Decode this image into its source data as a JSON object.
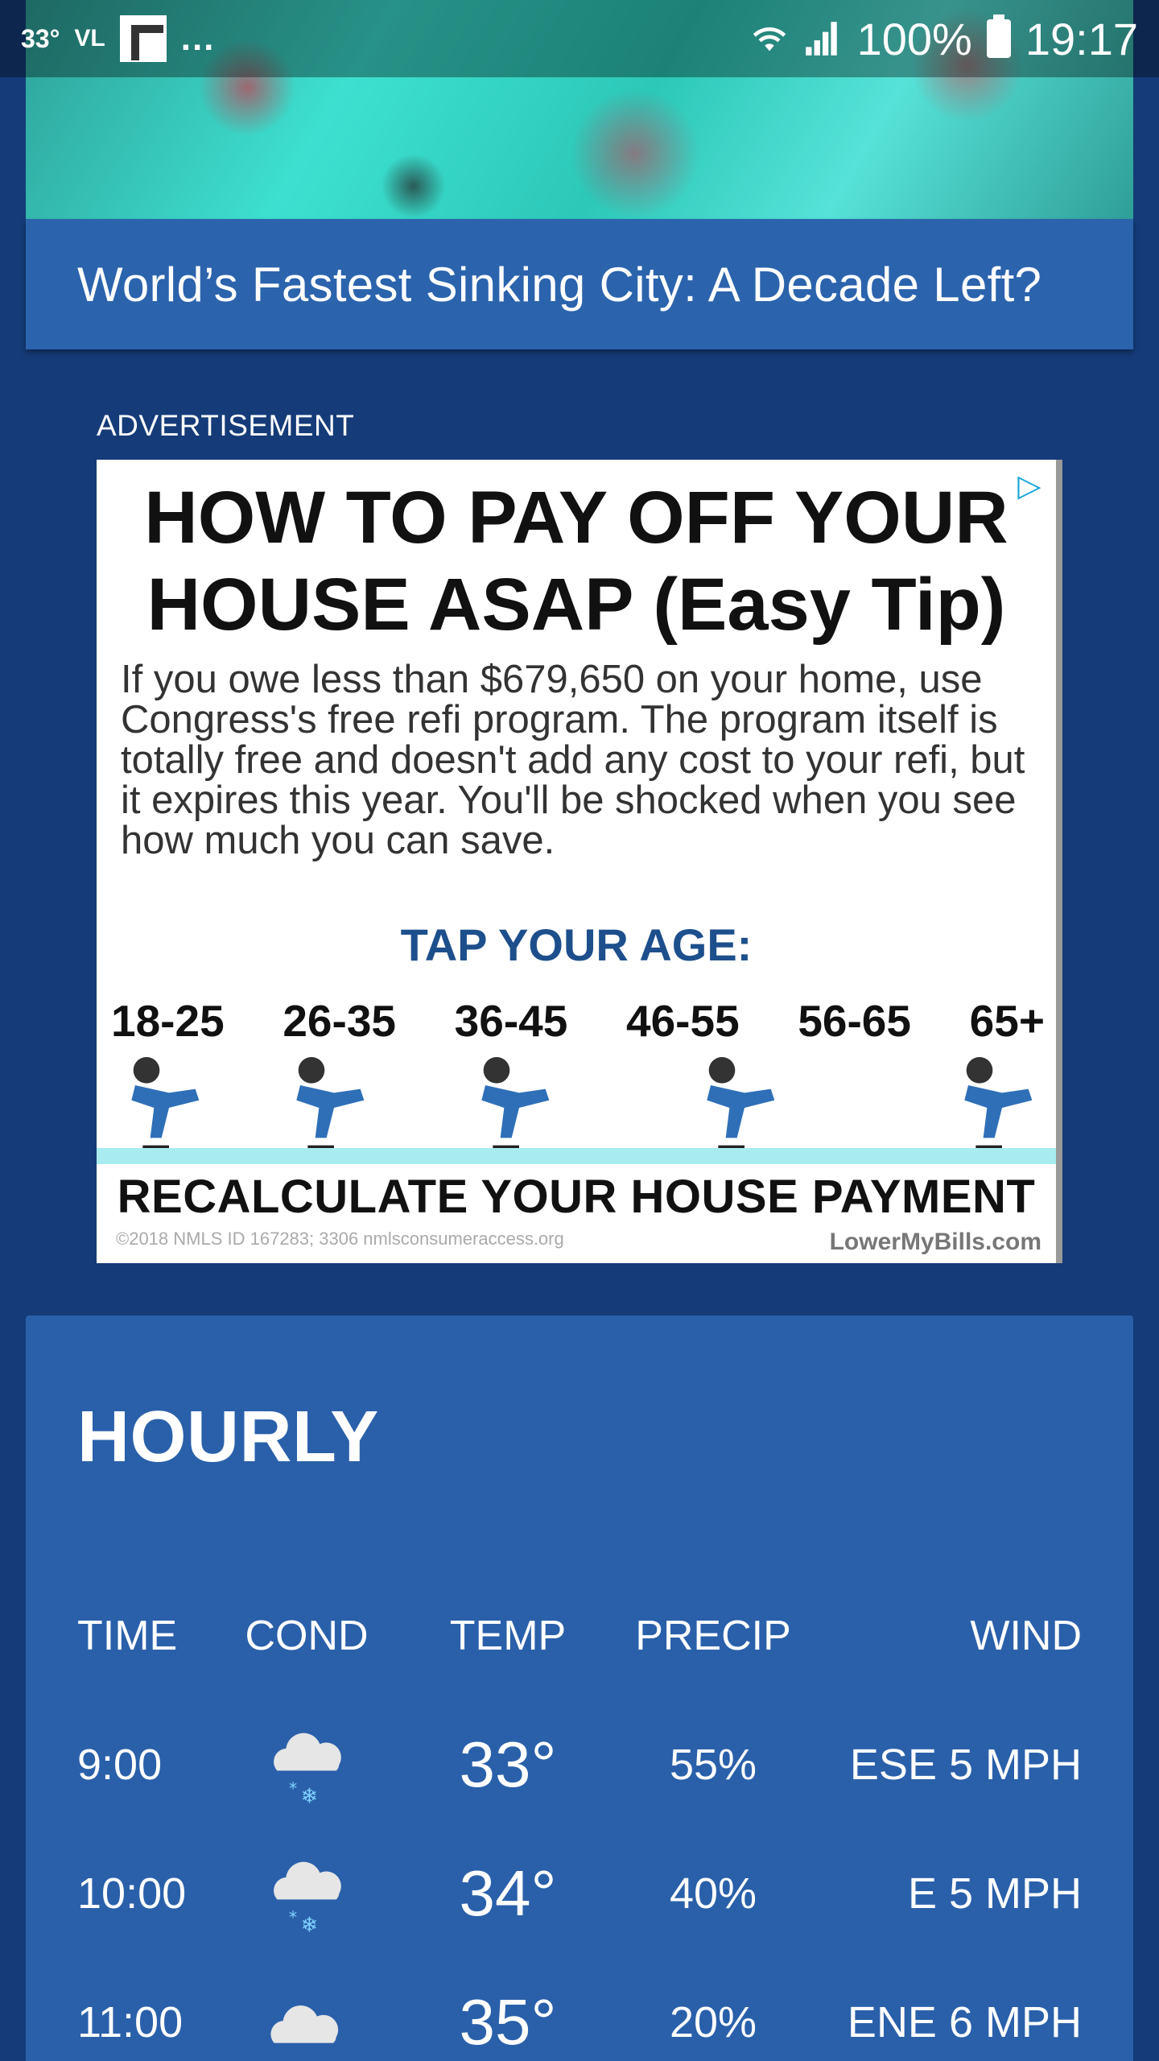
{
  "status_bar": {
    "temp": "33°",
    "carrier_tag": "VL",
    "more": "...",
    "battery": "100%",
    "time": "19:17"
  },
  "article": {
    "title": "World’s Fastest Sinking City: A Decade Left?"
  },
  "ad": {
    "label": "ADVERTISEMENT",
    "headline_1": "HOW TO PAY OFF YOUR",
    "headline_2": "HOUSE ASAP (Easy Tip)",
    "body": "If you owe less than $679,650 on your home, use Congress's free refi program. The program itself is totally free and doesn't add any cost to your refi, but it expires this year. You'll be shocked when you see how much you can save.",
    "cta": "TAP YOUR AGE:",
    "ages": [
      "18-25",
      "26-35",
      "36-45",
      "46-55",
      "56-65",
      "65+"
    ],
    "footer": "RECALCULATE YOUR HOUSE PAYMENT",
    "fine_print": "©2018    NMLS ID 167283; 3306    nmlsconsumeraccess.org",
    "brand": "LowerMyBills.com"
  },
  "hourly": {
    "title": "HOURLY",
    "headers": {
      "time": "TIME",
      "cond": "COND",
      "temp": "TEMP",
      "precip": "PRECIP",
      "wind": "WIND"
    },
    "rows": [
      {
        "time": "9:00",
        "cond": "snow-cloud-icon",
        "temp": "33°",
        "precip": "55%",
        "wind": "ESE 5 MPH"
      },
      {
        "time": "10:00",
        "cond": "snow-cloud-icon",
        "temp": "34°",
        "precip": "40%",
        "wind": "E 5 MPH"
      },
      {
        "time": "11:00",
        "cond": "cloud-icon",
        "temp": "35°",
        "precip": "20%",
        "wind": "ENE 6 MPH"
      }
    ]
  },
  "colors": {
    "page_bg": "#153b78",
    "card_bg": "#2a60aa",
    "caption_bg": "#2b63ad"
  }
}
